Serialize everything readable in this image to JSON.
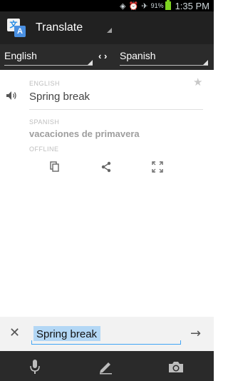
{
  "status_bar": {
    "battery_percent": "91%",
    "time": "1:35 PM",
    "icons": [
      "network-sync-icon",
      "alarm-icon",
      "airplane-mode-icon",
      "battery-icon"
    ]
  },
  "app_bar": {
    "title": "Translate",
    "logo_letters": [
      "文",
      "A"
    ]
  },
  "language_bar": {
    "source_language": "English",
    "target_language": "Spanish",
    "swap_label": "‹ ›"
  },
  "translation": {
    "source_label": "ENGLISH",
    "source_text": "Spring break",
    "target_label": "SPANISH",
    "target_text": "vacaciones de primavera",
    "offline_label": "OFFLINE"
  },
  "input": {
    "value": "Spring break",
    "clear_symbol": "✕",
    "go_symbol": "→"
  },
  "colors": {
    "action_bar": "#212121",
    "input_accent": "#42a5f5",
    "battery": "#7ed321"
  }
}
